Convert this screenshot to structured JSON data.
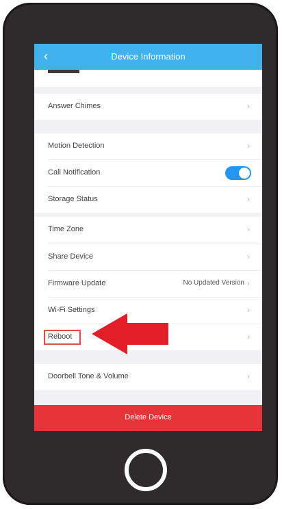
{
  "header": {
    "back_icon": "chevron-left-icon",
    "title": "Device Information"
  },
  "rows": {
    "answer_chimes": "Answer Chimes",
    "motion_detection": "Motion Detection",
    "call_notification": "Call Notification",
    "call_notification_enabled": true,
    "storage_status": "Storage Status",
    "time_zone": "Time Zone",
    "share_device": "Share Device",
    "firmware_update": "Firmware Update",
    "firmware_value": "No Updated Version",
    "wifi_settings": "Wi-Fi Settings",
    "reboot": "Reboot",
    "doorbell_tone": "Doorbell Tone & Volume"
  },
  "footer": {
    "delete_label": "Delete Device"
  },
  "colors": {
    "nav_bar": "#3fb2ee",
    "toggle": "#2196f3",
    "delete_button": "#e53539",
    "annotation_arrow": "#e21f26",
    "phone_body": "#2e2b2c"
  },
  "icons": {
    "chevron": "chevron-right-icon",
    "home": "home-button-icon"
  }
}
